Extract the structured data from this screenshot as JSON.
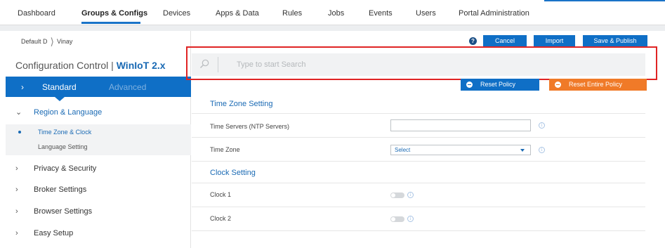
{
  "nav": {
    "items": [
      "Dashboard",
      "Groups & Configs",
      "Devices",
      "Apps & Data",
      "Rules",
      "Jobs",
      "Events",
      "Users",
      "Portal Administration"
    ],
    "active_index": 1
  },
  "breadcrumb": {
    "root": "Default D",
    "child": "Vinay"
  },
  "config": {
    "title_prefix": "Configuration Control |",
    "title_product": "WinIoT 2.x"
  },
  "tabs": {
    "standard": "Standard",
    "advanced": "Advanced"
  },
  "sidebar": {
    "categories": [
      {
        "label": "Region & Language",
        "expanded": true
      },
      {
        "label": "Privacy & Security"
      },
      {
        "label": "Broker Settings"
      },
      {
        "label": "Browser Settings"
      },
      {
        "label": "Easy Setup"
      }
    ],
    "subitems": [
      "Time Zone & Clock",
      "Language Setting"
    ]
  },
  "actions": {
    "help": "?",
    "cancel": "Cancel",
    "import": "Import",
    "save": "Save & Publish"
  },
  "search": {
    "placeholder": "Type to start Search"
  },
  "reset": {
    "policy": "Reset Policy",
    "entire": "Reset Entire Policy"
  },
  "settings": {
    "time_zone_section": "Time Zone Setting",
    "ntp_label": "Time Servers (NTP Servers)",
    "ntp_value": "",
    "tz_label": "Time Zone",
    "tz_value": "Select",
    "clock_section": "Clock Setting",
    "clock1_label": "Clock 1",
    "clock2_label": "Clock 2"
  },
  "colors": {
    "primary": "#0f6fc6",
    "orange": "#f07a28",
    "highlight": "#e02424"
  }
}
